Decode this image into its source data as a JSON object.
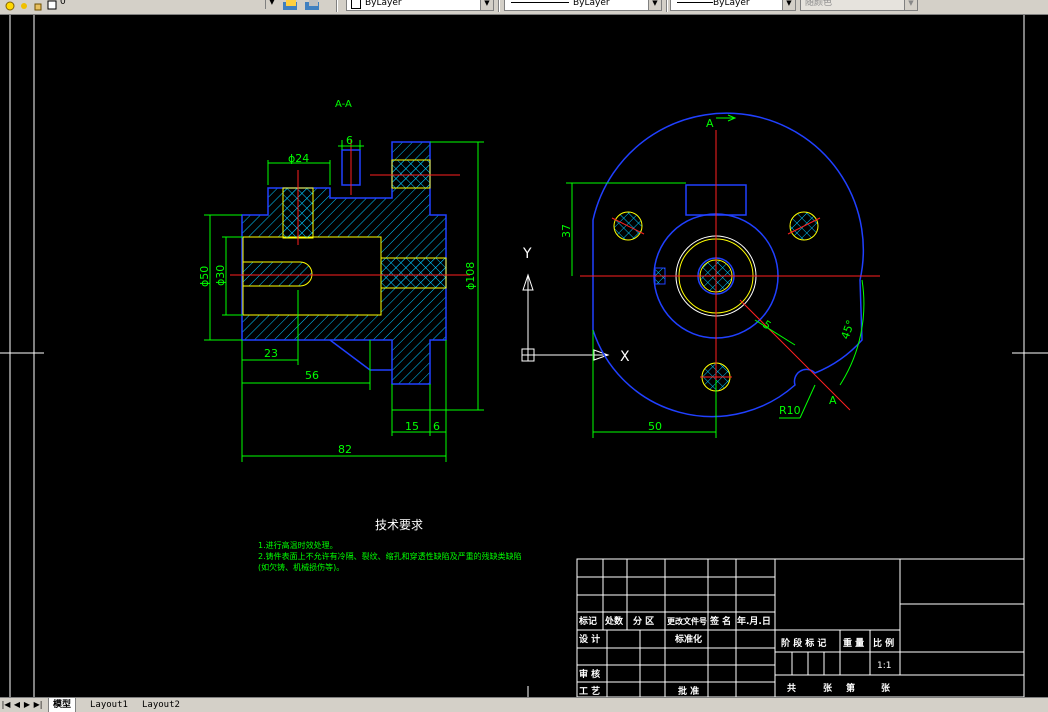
{
  "toolbar": {
    "layer_value": "0",
    "color_value": "ByLayer",
    "linetype_value": "ByLayer",
    "lineweight_value": "ByLayer",
    "plotstyle_value": "随颜色"
  },
  "drawing": {
    "section_label": "A-A",
    "dims": {
      "d6": "6",
      "d24": "ϕ24",
      "d50": "ϕ50",
      "d30": "ϕ30",
      "d23": "23",
      "d56": "56",
      "d82": "82",
      "d15": "15",
      "d6b": "6",
      "d108": "ϕ108",
      "d37": "37",
      "d50b": "50",
      "d45": "45°",
      "r10": "R10",
      "d5": "5",
      "cut_a_top": "A",
      "cut_a_bottom": "A"
    },
    "ucs": {
      "y": "Y",
      "x": "X"
    },
    "notes": {
      "title": "技术要求",
      "line1": "1.进行高温时效处理。",
      "line2": "2.铸件表面上不允许有冷隔、裂纹、缩孔和穿透性缺陷及严重的残缺类缺陷",
      "line3": "(如欠铸、机械损伤等)。"
    },
    "title_block": {
      "biaoji": "标记",
      "chushu": "处数",
      "fenqu": "分 区",
      "gengai": "更改文件号",
      "qianming": "签 名",
      "nianyueri": "年.月.日",
      "sheji": "设 计",
      "biaozhunhua": "标准化",
      "shenhe": "审 核",
      "gongyi": "工 艺",
      "pizhun": "批 准",
      "jieduan": "阶 段 标 记",
      "zhongliang": "重 量",
      "bili": "比 例",
      "scale": "1:1",
      "gong": "共",
      "zhang1": "张",
      "di": "第",
      "zhang2": "张"
    }
  },
  "tabs": {
    "model": "模型",
    "layout1": "Layout1",
    "layout2": "Layout2"
  }
}
